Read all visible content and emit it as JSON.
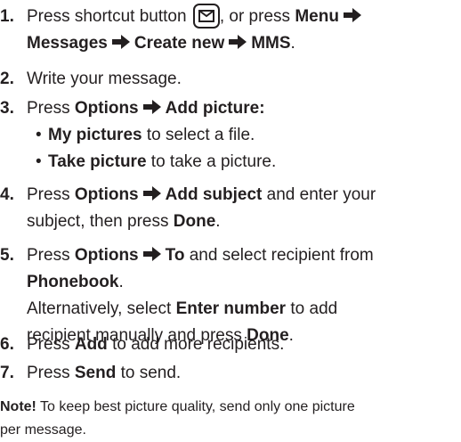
{
  "steps": [
    {
      "num": "1.",
      "pre": "Press shortcut button",
      "post": ", or press",
      "b1": "Menu",
      "b2": "Messages",
      "b3": "Create new",
      "b4": "MMS",
      "end": "."
    },
    {
      "num": "2.",
      "text": "Write your message."
    },
    {
      "num": "3.",
      "pre": "Press",
      "b1": "Options",
      "b2": "Add picture:",
      "bullets": [
        {
          "b": "My pictures",
          "text": " to select a file."
        },
        {
          "b": "Take picture",
          "text": " to take a picture."
        }
      ]
    },
    {
      "num": "4.",
      "pre": "Press",
      "b1": "Options",
      "b2": "Add subject",
      "post": " and enter your",
      "line2": "subject, then press",
      "b3": "Done",
      "end": "."
    },
    {
      "num": "5.",
      "pre": "Press",
      "b1": "Options",
      "b2": "To",
      "post": " and select recipient from",
      "b3": "Phonebook",
      "end": ".",
      "alt1": "Alternatively, select",
      "alt_b": "Enter number",
      "alt2": " to add",
      "alt3": "recipient manually and press",
      "alt_b2": "Done",
      "alt_end": "."
    },
    {
      "num": "6.",
      "pre": "Press",
      "b1": "Add",
      "post": " to add more recipients."
    },
    {
      "num": "7.",
      "pre": "Press",
      "b1": "Send",
      "post": " to send."
    }
  ],
  "note": {
    "label": "Note!",
    "line1": " To keep best picture quality, send only one picture",
    "line2": "per message."
  },
  "icons": {
    "arrow": "right-arrow-icon",
    "envelope": "envelope-key-icon"
  }
}
